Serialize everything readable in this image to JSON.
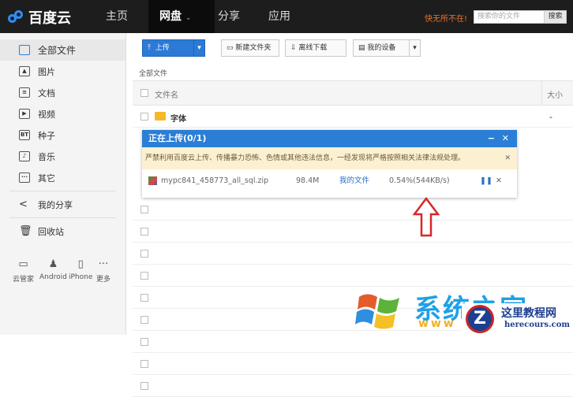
{
  "header": {
    "logo": "百度云",
    "nav": [
      "主页",
      "网盘",
      "分享",
      "应用"
    ],
    "slogan": "快无所不在!",
    "search_placeholder": "搜索你的文件",
    "search_button": "搜索"
  },
  "sidebar": {
    "items": [
      {
        "label": "全部文件",
        "icon": "drive-icon"
      },
      {
        "label": "图片",
        "icon": "image-icon"
      },
      {
        "label": "文档",
        "icon": "document-icon"
      },
      {
        "label": "视频",
        "icon": "video-icon"
      },
      {
        "label": "种子",
        "icon": "bt-icon"
      },
      {
        "label": "音乐",
        "icon": "music-icon"
      },
      {
        "label": "其它",
        "icon": "more-icon"
      },
      {
        "label": "我的分享",
        "icon": "share-icon"
      },
      {
        "label": "回收站",
        "icon": "trash-icon"
      }
    ],
    "devices": [
      "云管家",
      "Android",
      "iPhone",
      "更多"
    ]
  },
  "toolbar": {
    "upload": "上传",
    "new_folder": "新建文件夹",
    "offline": "离线下载",
    "devices": "我的设备"
  },
  "breadcrumb": "全部文件",
  "table": {
    "col_name": "文件名",
    "col_size": "大小",
    "rows": [
      {
        "name": "字体",
        "size": "-"
      }
    ]
  },
  "upload_panel": {
    "title": "正在上传(0/1)",
    "warning": "严禁利用百度云上传、传播暴力恐怖、色情或其他违法信息，一经发现将严格按照相关法律法规处理。",
    "file": {
      "name": "mypc841_458773_all_sql.zip",
      "size": "98.4M",
      "dest": "我的文件",
      "progress": "0.54%(544KB/s)",
      "progress_value": 0.54
    }
  },
  "watermark": {
    "brand1": "系统之家",
    "brand1_url": "www",
    "brand2": "这里教程网",
    "brand2_url": "herecours.com"
  },
  "colors": {
    "accent": "#2a7ed6",
    "arrow": "#d9262b"
  }
}
